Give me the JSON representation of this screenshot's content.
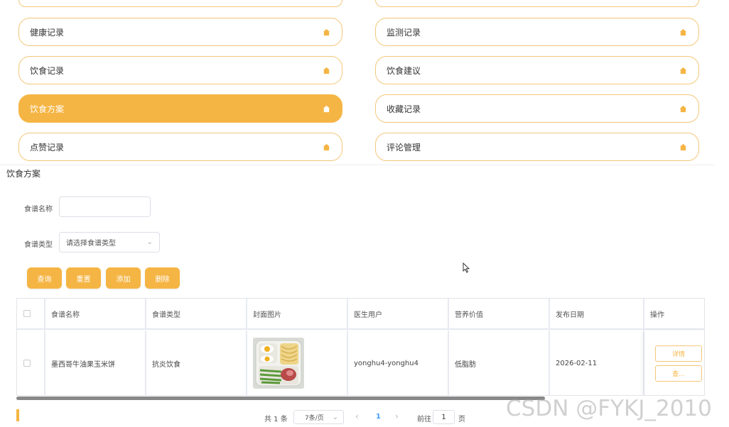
{
  "menu": {
    "items": [
      {
        "label": "健康记录"
      },
      {
        "label": "监测记录"
      },
      {
        "label": "饮食记录"
      },
      {
        "label": "饮食建议"
      },
      {
        "label": "饮食方案"
      },
      {
        "label": "收藏记录"
      },
      {
        "label": "点赞记录"
      },
      {
        "label": "评论管理"
      }
    ],
    "active": "饮食方案"
  },
  "section_title": "饮食方案",
  "search": {
    "name_label": "食谱名称",
    "name_value": "",
    "type_label": "食谱类型",
    "type_placeholder": "请选择食谱类型"
  },
  "actions": {
    "query": "查询",
    "reset": "重置",
    "add": "添加",
    "delete": "删除"
  },
  "table": {
    "headers": [
      "食谱名称",
      "食谱类型",
      "封面图片",
      "医生用户",
      "营养价值",
      "发布日期",
      "操作"
    ],
    "rows": [
      {
        "name": "墨西哥牛油果玉米饼",
        "type": "抗炎饮食",
        "image": "food-photo",
        "doctor": "yonghu4-yonghu4",
        "nutrition": "低脂肪",
        "date": "2026-02-11",
        "ops": [
          "详情",
          "查..."
        ]
      }
    ]
  },
  "pagination": {
    "total": "共 1 条",
    "page_size": "7条/页",
    "current": "1",
    "goto_label": "前往",
    "goto_value": "1",
    "page_suffix": "页"
  },
  "watermark": "CSDN @FYKJ_2010",
  "colors": {
    "accent": "#f5b544",
    "border": "#f3c77a",
    "link": "#409eff"
  }
}
